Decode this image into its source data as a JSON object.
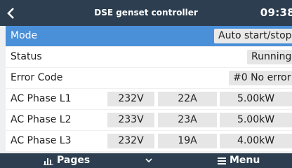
{
  "header": {
    "title": "DSE genset controller",
    "time": "09:38"
  },
  "rows": {
    "mode": {
      "label": "Mode",
      "value": "Auto start/stop"
    },
    "status": {
      "label": "Status",
      "value": "Running"
    },
    "error": {
      "label": "Error Code",
      "value": "#0 No error"
    },
    "phases": [
      {
        "label": "AC Phase L1",
        "voltage": "232V",
        "current": "22A",
        "power": "5.00kW"
      },
      {
        "label": "AC Phase L2",
        "voltage": "233V",
        "current": "23A",
        "power": "5.00kW"
      },
      {
        "label": "AC Phase L3",
        "voltage": "232V",
        "current": "19A",
        "power": "4.00kW"
      }
    ]
  },
  "footer": {
    "pages_label": "Pages",
    "menu_label": "Menu"
  },
  "colors": {
    "header_bg": "#2c3e4f",
    "selected_row": "#4a90d9",
    "page_bg": "#eef0f2"
  }
}
